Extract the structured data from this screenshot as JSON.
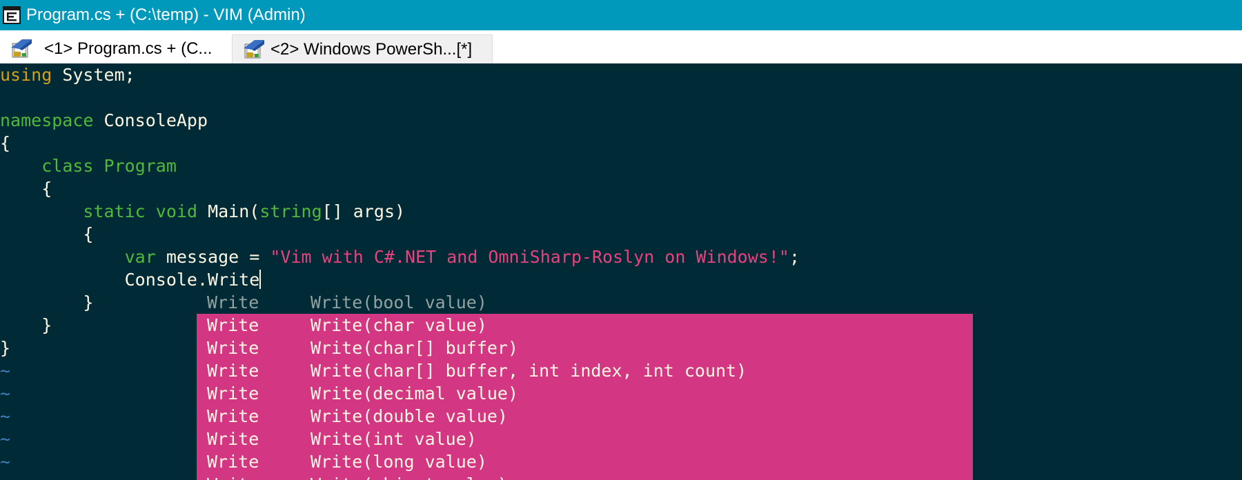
{
  "window": {
    "title": "Program.cs + (C:\\temp) - VIM (Admin)",
    "app_icon": "console-icon",
    "colors": {
      "titlebar_bg": "#0099bc",
      "editor_bg": "#002b36",
      "popup_bg": "#d33682"
    }
  },
  "tabs": [
    {
      "label": "<1> Program.cs + (C...",
      "icon": "vim-icon",
      "active": true
    },
    {
      "label": "<2> Windows PowerSh...[*]",
      "icon": "vim-icon",
      "active": false
    }
  ],
  "code": {
    "l1_kw": "using",
    "l1_rest": " System;",
    "l3_kw": "namespace",
    "l3_rest": " ConsoleApp",
    "l4": "{",
    "l5_indent": "    ",
    "l5_kw": "class",
    "l5_name": " Program",
    "l6": "    {",
    "l7_indent": "        ",
    "l7_kw1": "static",
    "l7_sp1": " ",
    "l7_kw2": "void",
    "l7_mid": " Main(",
    "l7_kw3": "string",
    "l7_rest": "[] args)",
    "l8": "        {",
    "l9_indent": "            ",
    "l9_kw": "var",
    "l9_mid": " message = ",
    "l9_str": "\"Vim with C#.NET and OmniSharp-Roslyn on Windows!\"",
    "l9_end": ";",
    "l10": "            Console.Write",
    "l11": "        }",
    "l12": "    }",
    "l13": "}",
    "tilde": "~"
  },
  "completion": {
    "items": [
      {
        "word": "Write",
        "menu": "Write(bool value)",
        "selected": true
      },
      {
        "word": "Write",
        "menu": "Write(char value)",
        "selected": false
      },
      {
        "word": "Write",
        "menu": "Write(char[] buffer)",
        "selected": false
      },
      {
        "word": "Write",
        "menu": "Write(char[] buffer, int index, int count)",
        "selected": false
      },
      {
        "word": "Write",
        "menu": "Write(decimal value)",
        "selected": false
      },
      {
        "word": "Write",
        "menu": "Write(double value)",
        "selected": false
      },
      {
        "word": "Write",
        "menu": "Write(int value)",
        "selected": false
      },
      {
        "word": "Write",
        "menu": "Write(long value)",
        "selected": false
      },
      {
        "word": "Write",
        "menu": "Write(object value)",
        "selected": false
      }
    ]
  }
}
